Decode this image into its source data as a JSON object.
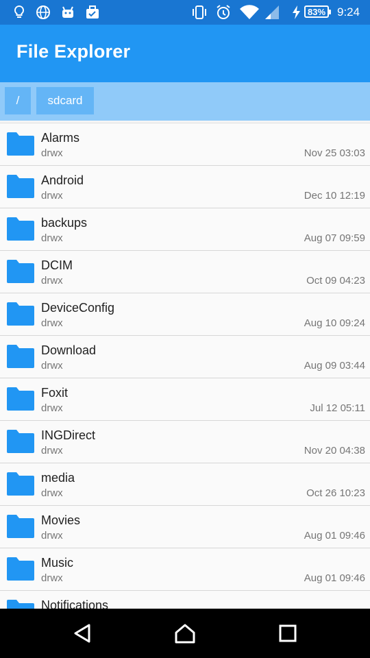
{
  "status_bar": {
    "left_icons": [
      "lightbulb-icon",
      "globe-icon",
      "android-icon",
      "briefcase-check-icon"
    ],
    "right_icons": [
      "vibrate-icon",
      "alarm-icon",
      "wifi-icon",
      "signal-icon",
      "charging-icon"
    ],
    "battery": "83%",
    "time": "9:24"
  },
  "app": {
    "title": "File Explorer"
  },
  "breadcrumb": [
    "/",
    "sdcard"
  ],
  "files": [
    {
      "name": "Alarms",
      "perm": "drwx",
      "date": "Nov 25 03:03"
    },
    {
      "name": "Android",
      "perm": "drwx",
      "date": "Dec 10 12:19"
    },
    {
      "name": "backups",
      "perm": "drwx",
      "date": "Aug 07 09:59"
    },
    {
      "name": "DCIM",
      "perm": "drwx",
      "date": "Oct 09 04:23"
    },
    {
      "name": "DeviceConfig",
      "perm": "drwx",
      "date": "Aug 10 09:24"
    },
    {
      "name": "Download",
      "perm": "drwx",
      "date": "Aug 09 03:44"
    },
    {
      "name": "Foxit",
      "perm": "drwx",
      "date": "Jul 12 05:11"
    },
    {
      "name": "INGDirect",
      "perm": "drwx",
      "date": "Nov 20 04:38"
    },
    {
      "name": "media",
      "perm": "drwx",
      "date": "Oct 26 10:23"
    },
    {
      "name": "Movies",
      "perm": "drwx",
      "date": "Aug 01 09:46"
    },
    {
      "name": "Music",
      "perm": "drwx",
      "date": "Aug 01 09:46"
    },
    {
      "name": "Notifications",
      "perm": "",
      "date": ""
    }
  ],
  "colors": {
    "status_bar": "#1976d2",
    "app_bar": "#2196f3",
    "breadcrumb_bar": "#90caf9",
    "breadcrumb_chip": "#64b5f6",
    "folder": "#2196f3"
  },
  "nav_bar": {
    "icons": [
      "back-icon",
      "home-icon",
      "recents-icon"
    ]
  }
}
